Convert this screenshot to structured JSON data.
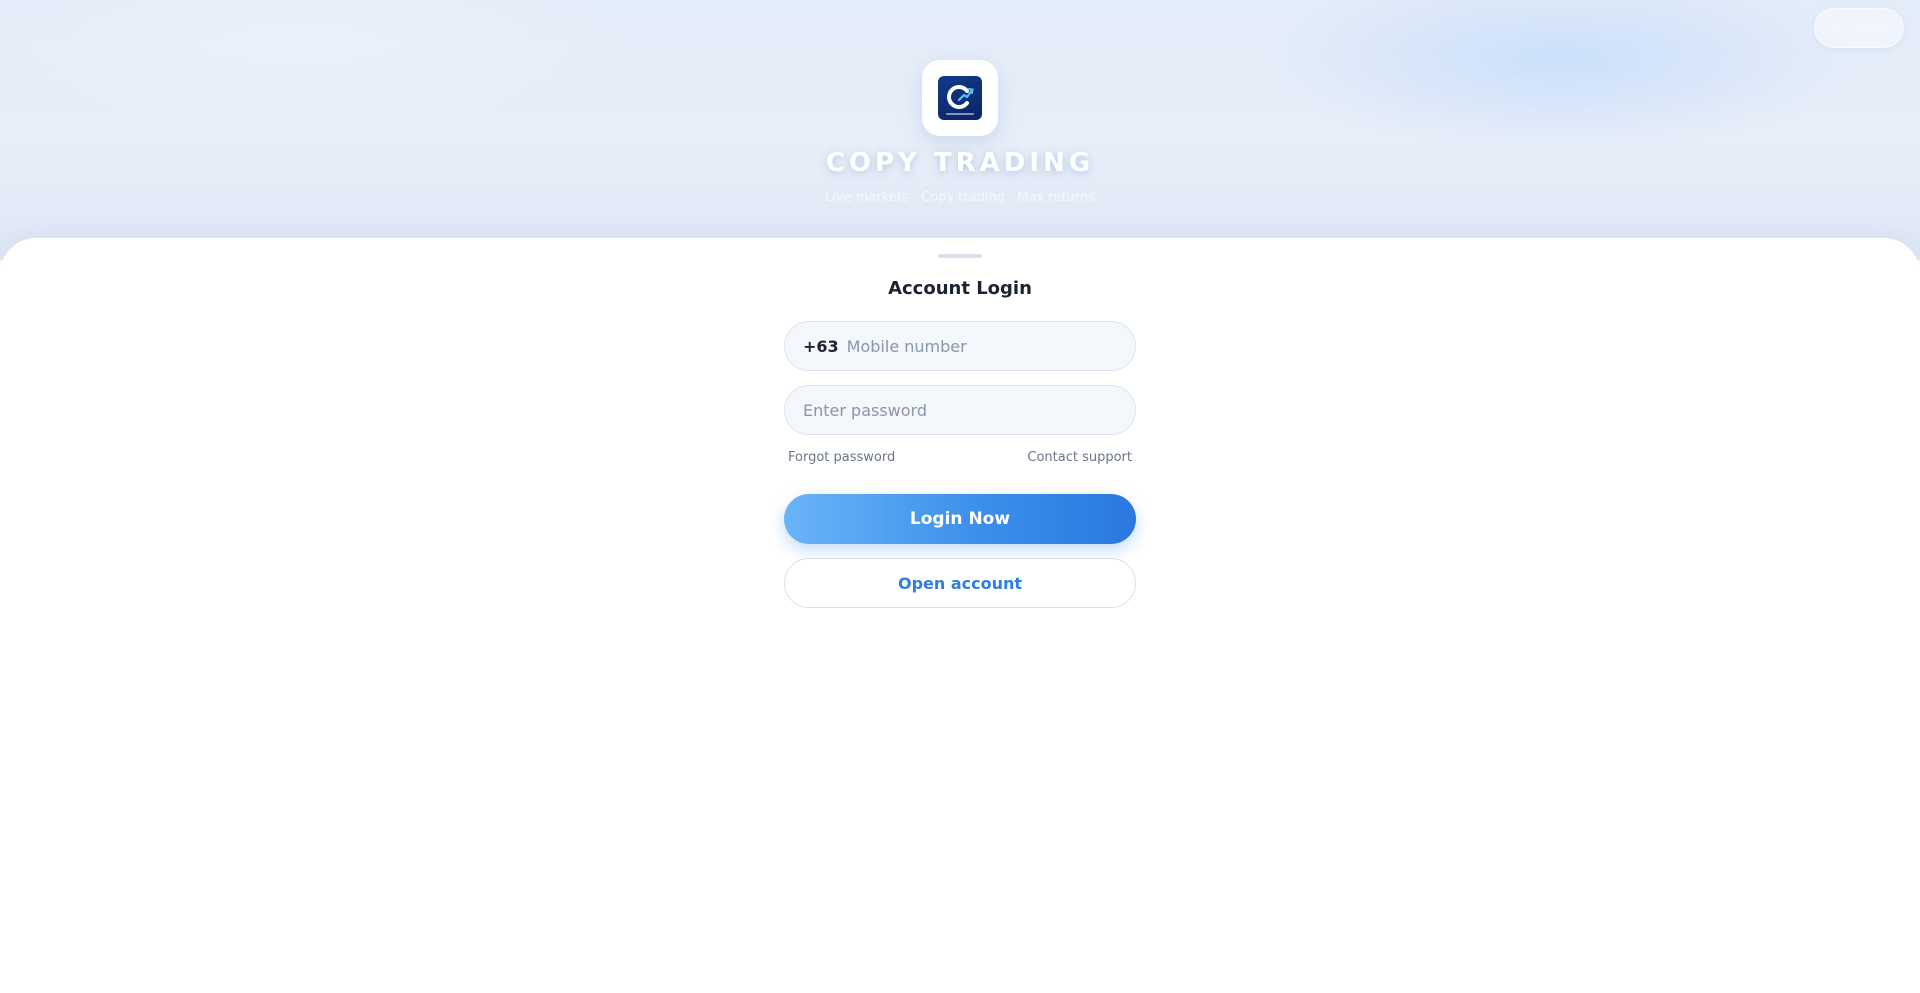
{
  "header": {
    "language_label": "Language",
    "brand": "COPY TRADING",
    "tagline": "Live markets · Copy trading · Max returns"
  },
  "login": {
    "title": "Account Login",
    "country_code": "+63",
    "mobile_placeholder": "Mobile number",
    "password_placeholder": "Enter password",
    "forgot_password": "Forgot password",
    "contact_support": "Contact support",
    "login_button": "Login Now",
    "open_account_button": "Open account"
  },
  "colors": {
    "primary": "#2a78e0",
    "primary_light": "#6ab4f8",
    "logo_bg": "#0b2566"
  }
}
